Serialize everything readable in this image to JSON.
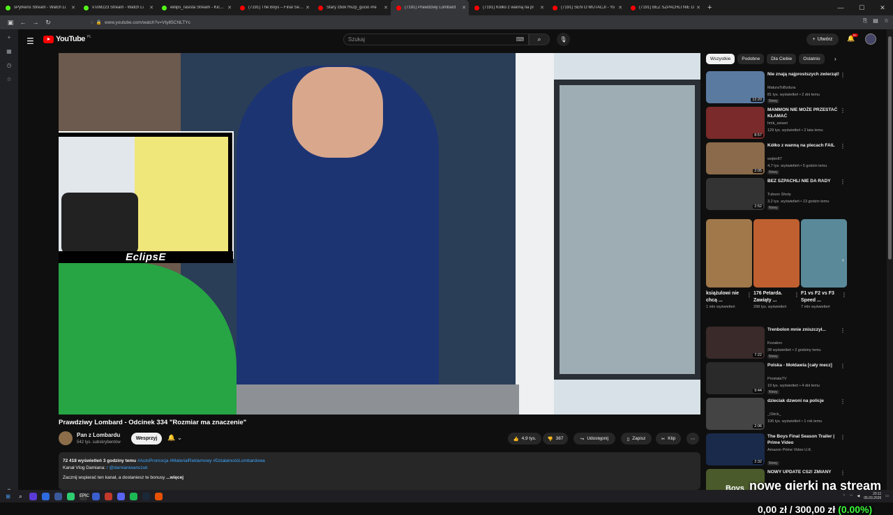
{
  "browser": {
    "tabs": [
      {
        "title": "sPyrkens Stream - Watch Li",
        "color": "#53fc18"
      },
      {
        "title": "xToM223 Stream - Watch Li",
        "color": "#53fc18"
      },
      {
        "title": "eklips_rasista Stream - Kick Da",
        "color": "#53fc18"
      },
      {
        "title": "(7191) The Boys – Final Season",
        "color": "#ff0000"
      },
      {
        "title": "Stary zbok f%2p_gucio #re",
        "color": "#ff0000"
      },
      {
        "title": "(7191) Prawdziwy Lombard",
        "color": "#ff0000",
        "active": true
      },
      {
        "title": "(7191) Kółko z wanną na pl",
        "color": "#ff0000"
      },
      {
        "title": "(7191) SEN O MUTACJI - Yo",
        "color": "#ff0000"
      },
      {
        "title": "(7191) BEZ SZPACHLI NIE D",
        "color": "#ff0000"
      }
    ],
    "url": "www.youtube.com/watch?v=Vty85CNLTYc"
  },
  "header": {
    "logo": "YouTube",
    "logo_country": "PL",
    "search_placeholder": "Szukaj",
    "create_label": "Utwórz",
    "notif_count": "9+"
  },
  "video": {
    "title": "Prawdziwy Lombard - Odcinek 334 \"Rozmiar ma znaczenie\"",
    "overlay_name": "EclipsE"
  },
  "channel": {
    "name": "Pan z Lombardu",
    "subs": "542 tys. subskrybentów",
    "support_label": "Wesprzyj"
  },
  "actions": {
    "likes": "4,9 tys.",
    "dislikes": "387",
    "share": "Udostępnij",
    "save": "Zapisz",
    "clip": "Klip"
  },
  "description": {
    "views": "72 418 wyświetleń",
    "ago": "3 godziny temu",
    "tags": "#AutoPromocja #MaterialReklamowy #DziałalnośćLombardowa",
    "line2_prefix": "Kanał Vlog Damiana:",
    "line2_link": "/ @darnianiwanczuk",
    "line3": "Zacznij wspierać ten kanał, a dostaniesz te bonusy",
    "more": "...więcej"
  },
  "chips": [
    "Wszystkie",
    "Podobne",
    "Dla Ciebie",
    "Ostatnio"
  ],
  "recommendations": [
    {
      "title": "Nie znają najprostszych zwierząt!",
      "channel": "MaturaToBzdura",
      "meta": "81 tys. wyświetleń • 2 dni temu",
      "badge": "Nowy",
      "duration": "12:20",
      "color": "#5a7aa0"
    },
    {
      "title": "MAMMON NIE MOŻE PRZESTAĆ KŁAMAĆ",
      "channel": "hmk_seiseri",
      "meta": "129 tys. wyświetleń • 2 lata temu",
      "badge": "",
      "duration": "8:57",
      "color": "#7a2a2a"
    },
    {
      "title": "Kółko z wanną na plecach FAIL",
      "channel": "wojter87",
      "meta": "4,7 tys. wyświetleń • 5 godzin temu",
      "badge": "Nowy",
      "duration": "2:05",
      "color": "#8a6a4a"
    },
    {
      "title": "BEZ SZPACHLI NIE DA RADY",
      "channel": "Tubson Shoty",
      "meta": "3,2 tys. wyświetleń • 13 godzin temu",
      "badge": "Nowy",
      "duration": "2:52",
      "color": "#333"
    }
  ],
  "shorts": [
    {
      "title": "książulowi nie chcą ...",
      "views": "1 mln wyświetleń",
      "color": "#a0784a"
    },
    {
      "title": "176 Petarda. Zawiąty ...",
      "views": "298 tys. wyświetleń",
      "color": "#c06030"
    },
    {
      "title": "F1 vs F2 vs F3 Speed ...",
      "views": "7 mln wyświetleń",
      "color": "#5a8a9a"
    }
  ],
  "recommendations2": [
    {
      "title": "Trenbolon mnie zniszczył...",
      "channel": "Kozakov",
      "meta": "28 wyświetleń • 2 godziny temu",
      "badge": "Nowy",
      "duration": "7:22",
      "color": "#3a2a2a"
    },
    {
      "title": "Polska - Mołdawia [cały mecz]",
      "channel": "ProstataTV",
      "meta": "19 tys. wyświetleń • 4 dni temu",
      "badge": "Nowy",
      "duration": "9:44",
      "color": "#2a2a2a"
    },
    {
      "title": "dzieciak dzwoni na policje",
      "channel": "_Okick_",
      "meta": "106 tys. wyświetleń • 1 rok temu",
      "badge": "",
      "duration": "2:06",
      "color": "#444"
    },
    {
      "title": "The Boys Final Season Trailer | Prime Video",
      "channel": "Amazon Prime Video U.K.",
      "meta": "",
      "badge": "Nowy",
      "duration": "2:32",
      "color": "#1a2a4a"
    },
    {
      "title": "NOWY UPDATE CS2! ZMIANY",
      "channel": "",
      "meta": "",
      "badge": "",
      "duration": "",
      "color": "#4a5a2a"
    }
  ],
  "stream_overlay": {
    "line1": "nowe gierki na stream",
    "amount": "0,00 zł / 300,00 zł",
    "percent": "(0.00%)"
  },
  "taskbar": {
    "time": "20:11",
    "date": "05.03.2026"
  }
}
